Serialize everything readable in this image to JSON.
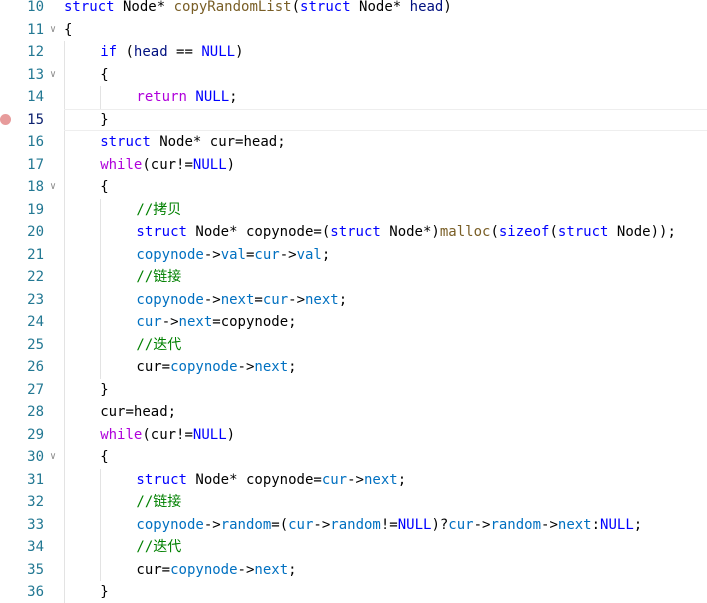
{
  "editor": {
    "breakpoint_line": 15,
    "active_line": 15,
    "colors": {
      "keyword": "#0000ff",
      "control": "#af00db",
      "function": "#795e26",
      "parameter": "#001080",
      "constant": "#0000ff",
      "variable": "#0070c1",
      "comment": "#008000",
      "line_number": "#237893",
      "breakpoint": "#e79b9b"
    },
    "lines": [
      {
        "num": "10",
        "fold": "",
        "indent": 0,
        "tokens": [
          {
            "t": "struct",
            "c": "kw"
          },
          {
            "t": " Node* ",
            "c": "tx"
          },
          {
            "t": "copyRandomList",
            "c": "fn"
          },
          {
            "t": "(",
            "c": "tx"
          },
          {
            "t": "struct",
            "c": "kw"
          },
          {
            "t": " Node* ",
            "c": "tx"
          },
          {
            "t": "head",
            "c": "param"
          },
          {
            "t": ")",
            "c": "tx"
          }
        ]
      },
      {
        "num": "11",
        "fold": "chevron-down",
        "indent": 0,
        "tokens": [
          {
            "t": "{",
            "c": "tx"
          }
        ]
      },
      {
        "num": "12",
        "fold": "",
        "indent": 1,
        "tokens": [
          {
            "t": "if",
            "c": "kw"
          },
          {
            "t": " (",
            "c": "tx"
          },
          {
            "t": "head",
            "c": "param"
          },
          {
            "t": " == ",
            "c": "tx"
          },
          {
            "t": "NULL",
            "c": "const"
          },
          {
            "t": ")",
            "c": "tx"
          }
        ]
      },
      {
        "num": "13",
        "fold": "chevron-down",
        "indent": 1,
        "tokens": [
          {
            "t": "{",
            "c": "tx"
          }
        ]
      },
      {
        "num": "14",
        "fold": "",
        "indent": 2,
        "tokens": [
          {
            "t": "return",
            "c": "ctl"
          },
          {
            "t": " ",
            "c": "tx"
          },
          {
            "t": "NULL",
            "c": "const"
          },
          {
            "t": ";",
            "c": "tx"
          }
        ]
      },
      {
        "num": "15",
        "fold": "",
        "indent": 1,
        "tokens": [
          {
            "t": "}",
            "c": "tx"
          }
        ]
      },
      {
        "num": "16",
        "fold": "",
        "indent": 1,
        "tokens": [
          {
            "t": "struct",
            "c": "kw"
          },
          {
            "t": " Node* cur=head;",
            "c": "tx"
          }
        ]
      },
      {
        "num": "17",
        "fold": "",
        "indent": 1,
        "tokens": [
          {
            "t": "while",
            "c": "ctl"
          },
          {
            "t": "(cur!=",
            "c": "tx"
          },
          {
            "t": "NULL",
            "c": "const"
          },
          {
            "t": ")",
            "c": "tx"
          }
        ]
      },
      {
        "num": "18",
        "fold": "chevron-down",
        "indent": 1,
        "tokens": [
          {
            "t": "{",
            "c": "tx"
          }
        ]
      },
      {
        "num": "19",
        "fold": "",
        "indent": 2,
        "tokens": [
          {
            "t": "//拷贝",
            "c": "cm"
          }
        ]
      },
      {
        "num": "20",
        "fold": "",
        "indent": 2,
        "tokens": [
          {
            "t": "struct",
            "c": "kw"
          },
          {
            "t": " Node* copynode=(",
            "c": "tx"
          },
          {
            "t": "struct",
            "c": "kw"
          },
          {
            "t": " Node*)",
            "c": "tx"
          },
          {
            "t": "malloc",
            "c": "fn"
          },
          {
            "t": "(",
            "c": "tx"
          },
          {
            "t": "sizeof",
            "c": "kw"
          },
          {
            "t": "(",
            "c": "tx"
          },
          {
            "t": "struct",
            "c": "kw"
          },
          {
            "t": " Node));",
            "c": "tx"
          }
        ]
      },
      {
        "num": "21",
        "fold": "",
        "indent": 2,
        "tokens": [
          {
            "t": "copynode",
            "c": "var"
          },
          {
            "t": "->",
            "c": "tx"
          },
          {
            "t": "val",
            "c": "var"
          },
          {
            "t": "=",
            "c": "tx"
          },
          {
            "t": "cur",
            "c": "var"
          },
          {
            "t": "->",
            "c": "tx"
          },
          {
            "t": "val",
            "c": "var"
          },
          {
            "t": ";",
            "c": "tx"
          }
        ]
      },
      {
        "num": "22",
        "fold": "",
        "indent": 2,
        "tokens": [
          {
            "t": "//链接",
            "c": "cm"
          }
        ]
      },
      {
        "num": "23",
        "fold": "",
        "indent": 2,
        "tokens": [
          {
            "t": "copynode",
            "c": "var"
          },
          {
            "t": "->",
            "c": "tx"
          },
          {
            "t": "next",
            "c": "var"
          },
          {
            "t": "=",
            "c": "tx"
          },
          {
            "t": "cur",
            "c": "var"
          },
          {
            "t": "->",
            "c": "tx"
          },
          {
            "t": "next",
            "c": "var"
          },
          {
            "t": ";",
            "c": "tx"
          }
        ]
      },
      {
        "num": "24",
        "fold": "",
        "indent": 2,
        "tokens": [
          {
            "t": "cur",
            "c": "var"
          },
          {
            "t": "->",
            "c": "tx"
          },
          {
            "t": "next",
            "c": "var"
          },
          {
            "t": "=copynode;",
            "c": "tx"
          }
        ]
      },
      {
        "num": "25",
        "fold": "",
        "indent": 2,
        "tokens": [
          {
            "t": "//迭代",
            "c": "cm"
          }
        ]
      },
      {
        "num": "26",
        "fold": "",
        "indent": 2,
        "tokens": [
          {
            "t": "cur=",
            "c": "tx"
          },
          {
            "t": "copynode",
            "c": "var"
          },
          {
            "t": "->",
            "c": "tx"
          },
          {
            "t": "next",
            "c": "var"
          },
          {
            "t": ";",
            "c": "tx"
          }
        ]
      },
      {
        "num": "27",
        "fold": "",
        "indent": 1,
        "tokens": [
          {
            "t": "}",
            "c": "tx"
          }
        ]
      },
      {
        "num": "28",
        "fold": "",
        "indent": 1,
        "tokens": [
          {
            "t": "cur=head;",
            "c": "tx"
          }
        ]
      },
      {
        "num": "29",
        "fold": "",
        "indent": 1,
        "tokens": [
          {
            "t": "while",
            "c": "ctl"
          },
          {
            "t": "(cur!=",
            "c": "tx"
          },
          {
            "t": "NULL",
            "c": "const"
          },
          {
            "t": ")",
            "c": "tx"
          }
        ]
      },
      {
        "num": "30",
        "fold": "chevron-down",
        "indent": 1,
        "tokens": [
          {
            "t": "{",
            "c": "tx"
          }
        ]
      },
      {
        "num": "31",
        "fold": "",
        "indent": 2,
        "tokens": [
          {
            "t": "struct",
            "c": "kw"
          },
          {
            "t": " Node* copynode=",
            "c": "tx"
          },
          {
            "t": "cur",
            "c": "var"
          },
          {
            "t": "->",
            "c": "tx"
          },
          {
            "t": "next",
            "c": "var"
          },
          {
            "t": ";",
            "c": "tx"
          }
        ]
      },
      {
        "num": "32",
        "fold": "",
        "indent": 2,
        "tokens": [
          {
            "t": "//链接",
            "c": "cm"
          }
        ]
      },
      {
        "num": "33",
        "fold": "",
        "indent": 2,
        "tokens": [
          {
            "t": "copynode",
            "c": "var"
          },
          {
            "t": "->",
            "c": "tx"
          },
          {
            "t": "random",
            "c": "var"
          },
          {
            "t": "=(",
            "c": "tx"
          },
          {
            "t": "cur",
            "c": "var"
          },
          {
            "t": "->",
            "c": "tx"
          },
          {
            "t": "random",
            "c": "var"
          },
          {
            "t": "!=",
            "c": "tx"
          },
          {
            "t": "NULL",
            "c": "const"
          },
          {
            "t": ")?",
            "c": "tx"
          },
          {
            "t": "cur",
            "c": "var"
          },
          {
            "t": "->",
            "c": "tx"
          },
          {
            "t": "random",
            "c": "var"
          },
          {
            "t": "->",
            "c": "tx"
          },
          {
            "t": "next",
            "c": "var"
          },
          {
            "t": ":",
            "c": "tx"
          },
          {
            "t": "NULL",
            "c": "const"
          },
          {
            "t": ";",
            "c": "tx"
          }
        ]
      },
      {
        "num": "34",
        "fold": "",
        "indent": 2,
        "tokens": [
          {
            "t": "//迭代",
            "c": "cm"
          }
        ]
      },
      {
        "num": "35",
        "fold": "",
        "indent": 2,
        "tokens": [
          {
            "t": "cur=",
            "c": "tx"
          },
          {
            "t": "copynode",
            "c": "var"
          },
          {
            "t": "->",
            "c": "tx"
          },
          {
            "t": "next",
            "c": "var"
          },
          {
            "t": ";",
            "c": "tx"
          }
        ]
      },
      {
        "num": "36",
        "fold": "",
        "indent": 1,
        "tokens": [
          {
            "t": "}",
            "c": "tx"
          }
        ]
      }
    ]
  }
}
